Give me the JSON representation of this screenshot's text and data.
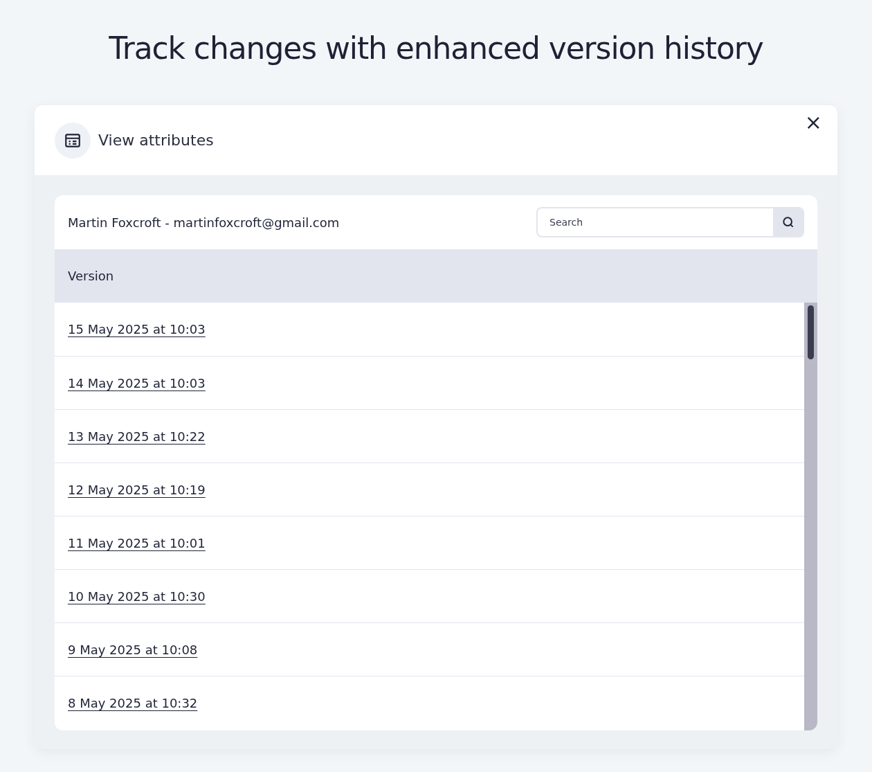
{
  "headline": "Track changes with enhanced version history",
  "dialog": {
    "title": "View attributes",
    "close": "×"
  },
  "panel": {
    "user": "Martin Foxcroft - martinfoxcroft@gmail.com",
    "search": {
      "placeholder": "Search"
    },
    "table": {
      "columns": [
        "Version"
      ],
      "rows": [
        {
          "version": "15 May 2025 at 10:03"
        },
        {
          "version": "14 May 2025 at 10:03"
        },
        {
          "version": "13 May 2025 at 10:22"
        },
        {
          "version": "12 May 2025 at 10:19"
        },
        {
          "version": "11 May 2025 at 10:01"
        },
        {
          "version": "10 May 2025 at 10:30"
        },
        {
          "version": "9 May 2025 at 10:08"
        },
        {
          "version": "8 May 2025 at 10:32"
        }
      ]
    }
  }
}
